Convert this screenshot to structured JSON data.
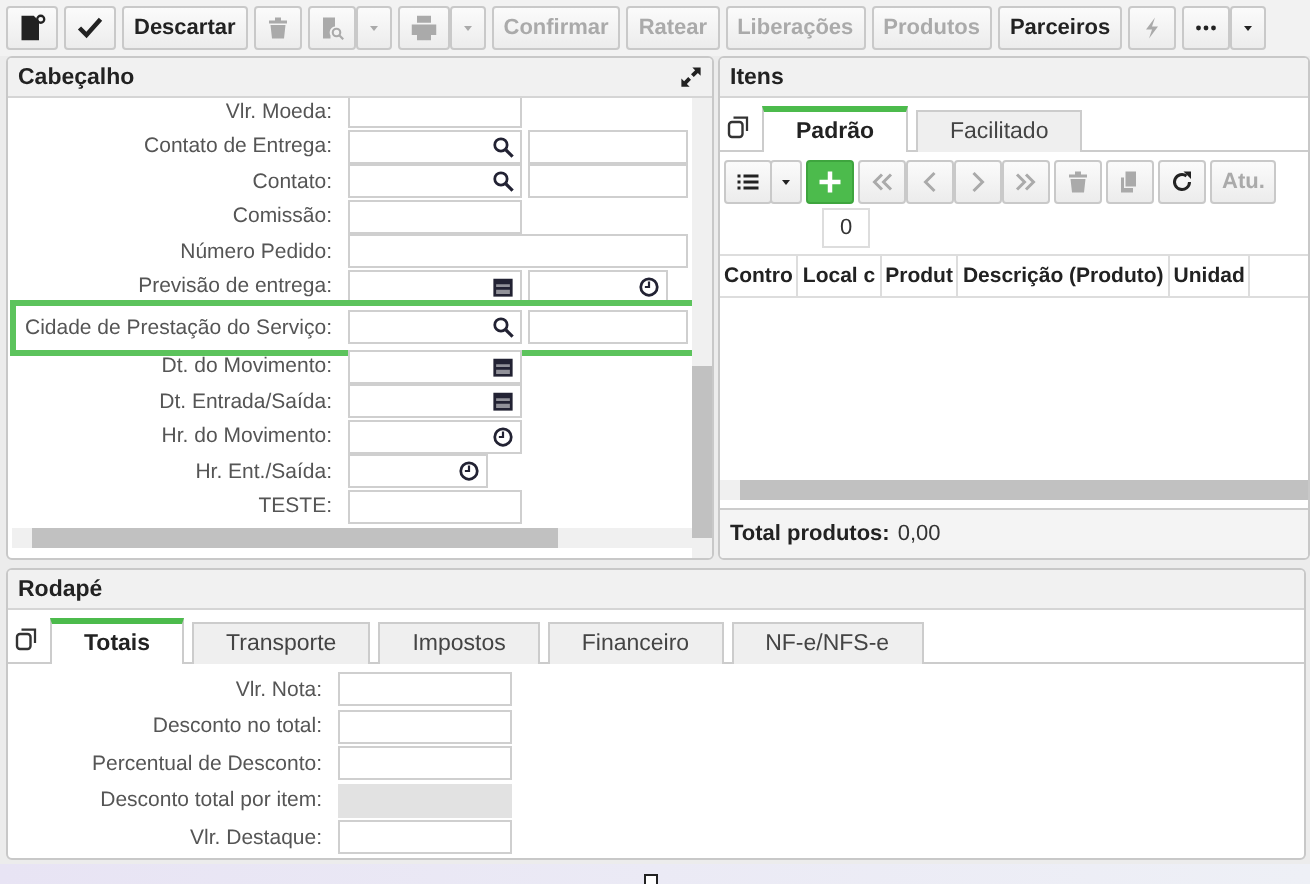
{
  "toolbar": [
    {
      "kind": "new",
      "disabled": false
    },
    {
      "kind": "save",
      "disabled": false
    },
    {
      "kind": "text",
      "label": "Descartar",
      "disabled": false
    },
    {
      "kind": "delete",
      "disabled": true
    },
    {
      "kind": "preview",
      "disabled": true,
      "dropdown": true
    },
    {
      "kind": "print",
      "disabled": true,
      "dropdown": true
    },
    {
      "kind": "text",
      "label": "Confirmar",
      "disabled": true
    },
    {
      "kind": "text",
      "label": "Ratear",
      "disabled": true
    },
    {
      "kind": "text",
      "label": "Liberações",
      "disabled": true
    },
    {
      "kind": "text",
      "label": "Produtos",
      "disabled": true
    },
    {
      "kind": "text",
      "label": "Parceiros",
      "disabled": false
    },
    {
      "kind": "action",
      "disabled": true
    },
    {
      "kind": "more",
      "disabled": false,
      "dropdown": true
    }
  ],
  "header_panel": {
    "title": "Cabeçalho",
    "fields": [
      {
        "label": "Vlr. Moeda:",
        "kind": "plain",
        "highlighted": false
      },
      {
        "label": "Contato de Entrega:",
        "kind": "search",
        "highlighted": false
      },
      {
        "label": "Contato:",
        "kind": "search",
        "highlighted": false
      },
      {
        "label": "Comissão:",
        "kind": "plain",
        "highlighted": false
      },
      {
        "label": "Número Pedido:",
        "kind": "wide",
        "highlighted": false
      },
      {
        "label": "Previsão de entrega:",
        "kind": "datetime",
        "highlighted": false
      },
      {
        "label": "Cidade de Prestação do Serviço:",
        "kind": "search",
        "highlighted": true
      },
      {
        "label": "Dt. do Movimento:",
        "kind": "date",
        "highlighted": false
      },
      {
        "label": "Dt. Entrada/Saída:",
        "kind": "date",
        "highlighted": false
      },
      {
        "label": "Hr. do Movimento:",
        "kind": "time",
        "highlighted": false
      },
      {
        "label": "Hr. Ent./Saída:",
        "kind": "short-time",
        "highlighted": false
      },
      {
        "label": "TESTE:",
        "kind": "plain",
        "highlighted": false
      }
    ]
  },
  "items_panel": {
    "title": "Itens",
    "tabs": [
      {
        "label": "Padrão",
        "selected": true
      },
      {
        "label": "Facilitado",
        "selected": false
      }
    ],
    "toolbar": [
      {
        "kind": "list",
        "disabled": false,
        "dropdown": true
      },
      {
        "kind": "add",
        "disabled": false
      },
      {
        "kind": "first",
        "disabled": true
      },
      {
        "kind": "previous",
        "disabled": true
      },
      {
        "kind": "next",
        "disabled": true
      },
      {
        "kind": "last",
        "disabled": true
      },
      {
        "kind": "delete",
        "disabled": true
      },
      {
        "kind": "copy",
        "disabled": true
      },
      {
        "kind": "refresh",
        "disabled": false
      },
      {
        "kind": "text",
        "label": "Atu.",
        "disabled": true
      }
    ],
    "tooltip": "0",
    "columns": [
      "Contro",
      "Local c",
      "Produt",
      "Descrição (Produto)",
      "Unidad"
    ],
    "total_label": "Total produtos:",
    "total_value": "0,00"
  },
  "footer_panel": {
    "title": "Rodapé",
    "tabs": [
      {
        "label": "Totais",
        "selected": true
      },
      {
        "label": "Transporte",
        "selected": false
      },
      {
        "label": "Impostos",
        "selected": false
      },
      {
        "label": "Financeiro",
        "selected": false
      },
      {
        "label": "NF-e/NFS-e",
        "selected": false
      }
    ],
    "fields": [
      {
        "label": "Vlr. Nota:",
        "disabled": false
      },
      {
        "label": "Desconto no total:",
        "disabled": false
      },
      {
        "label": "Percentual de Desconto:",
        "disabled": false
      },
      {
        "label": "Desconto total por item:",
        "disabled": true
      },
      {
        "label": "Vlr. Destaque:",
        "disabled": false
      }
    ]
  }
}
